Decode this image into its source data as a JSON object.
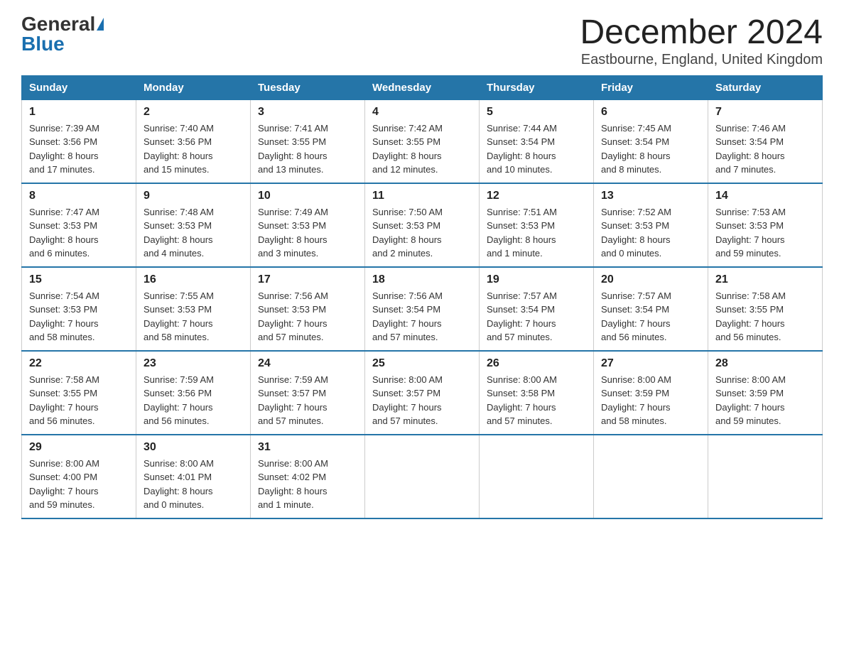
{
  "header": {
    "logo_general": "General",
    "logo_blue": "Blue",
    "title": "December 2024",
    "subtitle": "Eastbourne, England, United Kingdom"
  },
  "days_of_week": [
    "Sunday",
    "Monday",
    "Tuesday",
    "Wednesday",
    "Thursday",
    "Friday",
    "Saturday"
  ],
  "weeks": [
    [
      {
        "day": "1",
        "sunrise": "7:39 AM",
        "sunset": "3:56 PM",
        "daylight": "8 hours and 17 minutes."
      },
      {
        "day": "2",
        "sunrise": "7:40 AM",
        "sunset": "3:56 PM",
        "daylight": "8 hours and 15 minutes."
      },
      {
        "day": "3",
        "sunrise": "7:41 AM",
        "sunset": "3:55 PM",
        "daylight": "8 hours and 13 minutes."
      },
      {
        "day": "4",
        "sunrise": "7:42 AM",
        "sunset": "3:55 PM",
        "daylight": "8 hours and 12 minutes."
      },
      {
        "day": "5",
        "sunrise": "7:44 AM",
        "sunset": "3:54 PM",
        "daylight": "8 hours and 10 minutes."
      },
      {
        "day": "6",
        "sunrise": "7:45 AM",
        "sunset": "3:54 PM",
        "daylight": "8 hours and 8 minutes."
      },
      {
        "day": "7",
        "sunrise": "7:46 AM",
        "sunset": "3:54 PM",
        "daylight": "8 hours and 7 minutes."
      }
    ],
    [
      {
        "day": "8",
        "sunrise": "7:47 AM",
        "sunset": "3:53 PM",
        "daylight": "8 hours and 6 minutes."
      },
      {
        "day": "9",
        "sunrise": "7:48 AM",
        "sunset": "3:53 PM",
        "daylight": "8 hours and 4 minutes."
      },
      {
        "day": "10",
        "sunrise": "7:49 AM",
        "sunset": "3:53 PM",
        "daylight": "8 hours and 3 minutes."
      },
      {
        "day": "11",
        "sunrise": "7:50 AM",
        "sunset": "3:53 PM",
        "daylight": "8 hours and 2 minutes."
      },
      {
        "day": "12",
        "sunrise": "7:51 AM",
        "sunset": "3:53 PM",
        "daylight": "8 hours and 1 minute."
      },
      {
        "day": "13",
        "sunrise": "7:52 AM",
        "sunset": "3:53 PM",
        "daylight": "8 hours and 0 minutes."
      },
      {
        "day": "14",
        "sunrise": "7:53 AM",
        "sunset": "3:53 PM",
        "daylight": "7 hours and 59 minutes."
      }
    ],
    [
      {
        "day": "15",
        "sunrise": "7:54 AM",
        "sunset": "3:53 PM",
        "daylight": "7 hours and 58 minutes."
      },
      {
        "day": "16",
        "sunrise": "7:55 AM",
        "sunset": "3:53 PM",
        "daylight": "7 hours and 58 minutes."
      },
      {
        "day": "17",
        "sunrise": "7:56 AM",
        "sunset": "3:53 PM",
        "daylight": "7 hours and 57 minutes."
      },
      {
        "day": "18",
        "sunrise": "7:56 AM",
        "sunset": "3:54 PM",
        "daylight": "7 hours and 57 minutes."
      },
      {
        "day": "19",
        "sunrise": "7:57 AM",
        "sunset": "3:54 PM",
        "daylight": "7 hours and 57 minutes."
      },
      {
        "day": "20",
        "sunrise": "7:57 AM",
        "sunset": "3:54 PM",
        "daylight": "7 hours and 56 minutes."
      },
      {
        "day": "21",
        "sunrise": "7:58 AM",
        "sunset": "3:55 PM",
        "daylight": "7 hours and 56 minutes."
      }
    ],
    [
      {
        "day": "22",
        "sunrise": "7:58 AM",
        "sunset": "3:55 PM",
        "daylight": "7 hours and 56 minutes."
      },
      {
        "day": "23",
        "sunrise": "7:59 AM",
        "sunset": "3:56 PM",
        "daylight": "7 hours and 56 minutes."
      },
      {
        "day": "24",
        "sunrise": "7:59 AM",
        "sunset": "3:57 PM",
        "daylight": "7 hours and 57 minutes."
      },
      {
        "day": "25",
        "sunrise": "8:00 AM",
        "sunset": "3:57 PM",
        "daylight": "7 hours and 57 minutes."
      },
      {
        "day": "26",
        "sunrise": "8:00 AM",
        "sunset": "3:58 PM",
        "daylight": "7 hours and 57 minutes."
      },
      {
        "day": "27",
        "sunrise": "8:00 AM",
        "sunset": "3:59 PM",
        "daylight": "7 hours and 58 minutes."
      },
      {
        "day": "28",
        "sunrise": "8:00 AM",
        "sunset": "3:59 PM",
        "daylight": "7 hours and 59 minutes."
      }
    ],
    [
      {
        "day": "29",
        "sunrise": "8:00 AM",
        "sunset": "4:00 PM",
        "daylight": "7 hours and 59 minutes."
      },
      {
        "day": "30",
        "sunrise": "8:00 AM",
        "sunset": "4:01 PM",
        "daylight": "8 hours and 0 minutes."
      },
      {
        "day": "31",
        "sunrise": "8:00 AM",
        "sunset": "4:02 PM",
        "daylight": "8 hours and 1 minute."
      },
      null,
      null,
      null,
      null
    ]
  ],
  "labels": {
    "sunrise_prefix": "Sunrise: ",
    "sunset_prefix": "Sunset: ",
    "daylight_prefix": "Daylight: "
  }
}
